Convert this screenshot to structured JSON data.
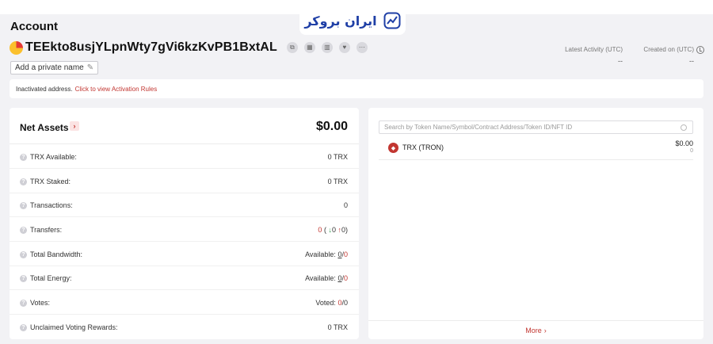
{
  "brand": {
    "logo_text": "ایران بروکر",
    "color": "#1f3fa6"
  },
  "account": {
    "title": "Account",
    "address": "TEEkto8usjYLpnWty7gVi6kzKvPB1BxtAL",
    "private_name_label": "Add a private name",
    "latest_activity_label": "Latest Activity (UTC)",
    "latest_activity_value": "--",
    "created_on_label": "Created on (UTC)",
    "created_on_value": "--"
  },
  "notice": {
    "text": "Inactivated address.",
    "link": "Click to view Activation Rules"
  },
  "assets": {
    "title": "Net Assets",
    "value": "$0.00",
    "rows": {
      "trx_available": {
        "label": "TRX Available:",
        "value": "0 TRX"
      },
      "trx_staked": {
        "label": "TRX Staked:",
        "value": "0 TRX"
      },
      "transactions": {
        "label": "Transactions:",
        "value": "0"
      },
      "transfers": {
        "label": "Transfers:",
        "total": "0",
        "open": "(",
        "in_count": "0",
        "out_count": "0",
        "close": ")"
      },
      "bandwidth": {
        "label": "Total Bandwidth:",
        "prefix": "Available:",
        "used": "0",
        "sep": "/",
        "total": "0"
      },
      "energy": {
        "label": "Total Energy:",
        "prefix": "Available:",
        "used": "0",
        "sep": "/",
        "total": "0"
      },
      "votes": {
        "label": "Votes:",
        "prefix": "Voted:",
        "used": "0",
        "sep": "/",
        "total": "0"
      },
      "rewards": {
        "label": "Unclaimed Voting Rewards:",
        "value": "0 TRX"
      }
    }
  },
  "tokens": {
    "search_placeholder": "Search by Token Name/Symbol/Contract Address/Token ID/NFT ID",
    "items": [
      {
        "name": "TRX (TRON)",
        "value": "$0.00",
        "quantity": "0"
      }
    ],
    "more_label": "More"
  },
  "colors": {
    "accent": "#c23631",
    "in_arrow": "#2e9b4a",
    "out_arrow": "#c23631"
  }
}
